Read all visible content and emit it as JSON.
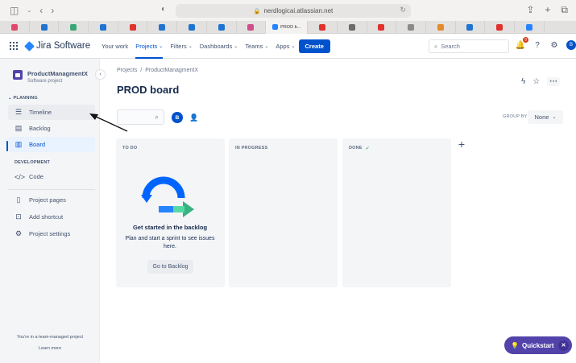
{
  "browser": {
    "url": "nerdlogicai.atlassian.net",
    "active_tab_label": "PROD b...",
    "favorites_colors": [
      "#e5466b",
      "#1f73d1",
      "#3aa676",
      "#1f73d1",
      "#e0322e",
      "#1f73d1",
      "#1f73d1",
      "#1f73d1",
      "#d14d8b",
      "#2684ff",
      "#e0322e",
      "#6b6b6b",
      "#e0322e",
      "#8a8a8a",
      "#e58a2a",
      "#1f73d1",
      "#e0322e",
      "#2684ff"
    ]
  },
  "topnav": {
    "product_name": "Jira Software",
    "items": [
      {
        "label": "Your work",
        "active": false
      },
      {
        "label": "Projects",
        "active": true
      },
      {
        "label": "Filters",
        "active": false
      },
      {
        "label": "Dashboards",
        "active": false
      },
      {
        "label": "Teams",
        "active": false
      },
      {
        "label": "Apps",
        "active": false
      }
    ],
    "create_label": "Create",
    "search_placeholder": "Search",
    "notification_count": "9",
    "avatar_initial": "B"
  },
  "sidebar": {
    "project_name": "ProductManagmentX",
    "project_type": "Software project",
    "planning_header": "PLANNING",
    "planning_items": [
      {
        "label": "Timeline",
        "icon": "timeline-icon"
      },
      {
        "label": "Backlog",
        "icon": "backlog-icon"
      },
      {
        "label": "Board",
        "icon": "board-icon"
      }
    ],
    "development_header": "DEVELOPMENT",
    "dev_items": [
      {
        "label": "Code",
        "icon": "code-icon"
      }
    ],
    "other_items": [
      {
        "label": "Project pages",
        "icon": "pages-icon"
      },
      {
        "label": "Add shortcut",
        "icon": "add-shortcut-icon"
      },
      {
        "label": "Project settings",
        "icon": "settings-icon"
      }
    ],
    "footer_text": "You're in a team-managed project",
    "learn_more": "Learn more"
  },
  "board": {
    "breadcrumb": [
      "Projects",
      "ProductManagmentX"
    ],
    "title": "PROD board",
    "avatar_initial": "B",
    "group_by_label": "GROUP BY",
    "group_by_value": "None",
    "columns": [
      {
        "label": "TO DO"
      },
      {
        "label": "IN PROGRESS"
      },
      {
        "label": "DONE"
      }
    ],
    "empty_title": "Get started in the backlog",
    "empty_desc": "Plan and start a sprint to see issues here.",
    "empty_button": "Go to Backlog"
  },
  "quickstart": {
    "label": "Quickstart"
  },
  "colors": {
    "accent": "#0052cc",
    "sidebar_bg": "#f4f5f7",
    "quickstart": "#5243aa",
    "done_check": "#36b37e"
  }
}
